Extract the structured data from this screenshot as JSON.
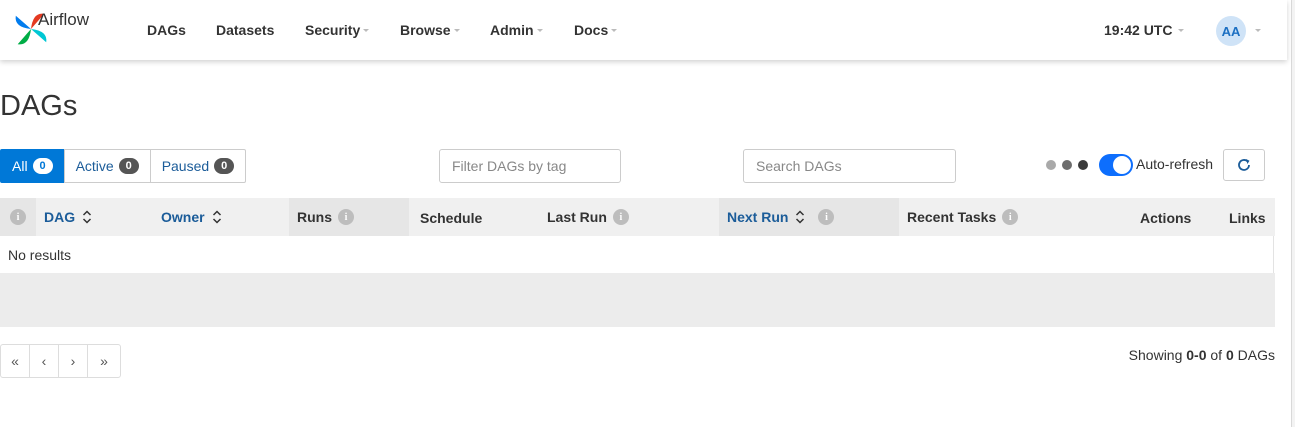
{
  "navbar": {
    "brand": "Airflow",
    "items": [
      {
        "label": "DAGs",
        "dropdown": false
      },
      {
        "label": "Datasets",
        "dropdown": false
      },
      {
        "label": "Security",
        "dropdown": true
      },
      {
        "label": "Browse",
        "dropdown": true
      },
      {
        "label": "Admin",
        "dropdown": true
      },
      {
        "label": "Docs",
        "dropdown": true
      }
    ],
    "clock": "19:42 UTC",
    "avatar_initials": "AA",
    "logo_colors": [
      "#e43921",
      "#00ad46",
      "#04d659",
      "#017cee",
      "#00c7d4"
    ]
  },
  "page": {
    "title": "DAGs"
  },
  "filters": {
    "all_label": "All",
    "all_count": "0",
    "active_label": "Active",
    "active_count": "0",
    "paused_label": "Paused",
    "paused_count": "0",
    "tag_placeholder": "Filter DAGs by tag",
    "search_placeholder": "Search DAGs"
  },
  "autorefresh": {
    "label": "Auto-refresh",
    "enabled": true,
    "dot_colors": [
      "#a9a9a9",
      "#6d6d6d",
      "#3a3a3a"
    ],
    "toggle_color": "#0d6efd"
  },
  "table": {
    "headers": {
      "dag": "DAG",
      "owner": "Owner",
      "runs": "Runs",
      "schedule": "Schedule",
      "last_run": "Last Run",
      "next_run": "Next Run",
      "recent_tasks": "Recent Tasks",
      "actions": "Actions",
      "links": "Links"
    },
    "empty_text": "No results"
  },
  "pagination": {
    "first": "«",
    "prev": "‹",
    "next": "›",
    "last": "»",
    "showing_prefix": "Showing ",
    "range": "0-0",
    "of": " of ",
    "total": "0",
    "suffix": " DAGs"
  },
  "colors": {
    "accent": "#0078d7",
    "link": "#1b5c99"
  }
}
